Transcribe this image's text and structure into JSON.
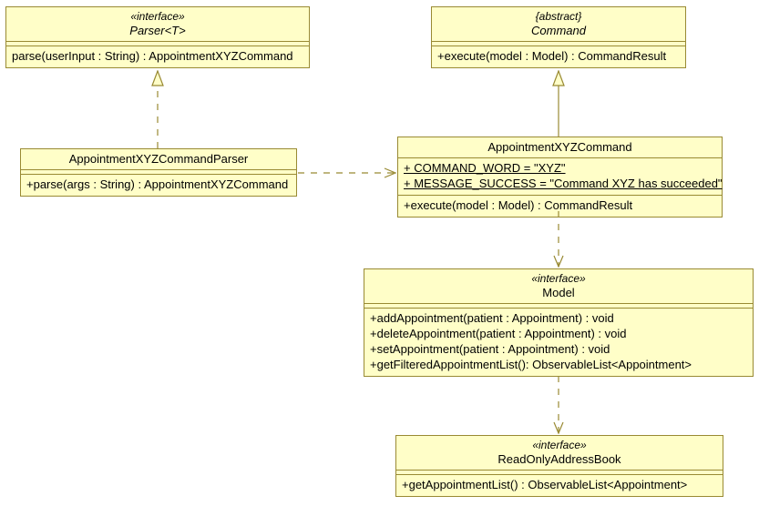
{
  "parser": {
    "stereo": "«interface»",
    "name": "Parser<T>",
    "op1": "parse(userInput : String) : AppointmentXYZCommand"
  },
  "command": {
    "stereo": "{abstract}",
    "name": "Command",
    "op1": "+execute(model : Model) : CommandResult"
  },
  "cmdParser": {
    "name": "AppointmentXYZCommandParser",
    "op1": "+parse(args : String) : AppointmentXYZCommand"
  },
  "apptCmd": {
    "name": "AppointmentXYZCommand",
    "attr1": "+ COMMAND_WORD = \"XYZ\"",
    "attr2": "+ MESSAGE_SUCCESS = \"Command XYZ has succeeded\"",
    "op1": "+execute(model : Model) : CommandResult"
  },
  "model": {
    "stereo": "«interface»",
    "name": "Model",
    "op1": "+addAppointment(patient : Appointment) : void",
    "op2": "+deleteAppointment(patient : Appointment) : void",
    "op3": "+setAppointment(patient : Appointment) : void",
    "op4": "+getFilteredAppointmentList(): ObservableList<Appointment>"
  },
  "roab": {
    "stereo": "«interface»",
    "name": "ReadOnlyAddressBook",
    "op1": "+getAppointmentList() : ObservableList<Appointment>"
  }
}
